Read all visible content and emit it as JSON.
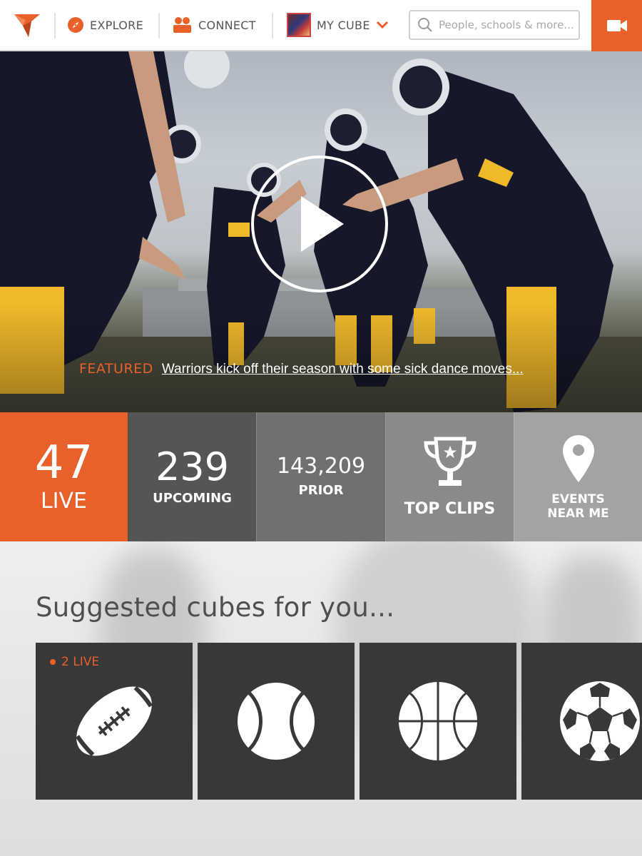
{
  "nav": {
    "explore_label": "EXPLORE",
    "connect_label": "CONNECT",
    "my_cube_label": "MY CUBE",
    "search_placeholder": "People, schools & more...",
    "accent_color": "#e8612a"
  },
  "hero": {
    "featured_tag": "FEATURED",
    "featured_title": "Warriors kick off their season with some sick dance moves..."
  },
  "stats": {
    "live": {
      "value": "47",
      "label": "LIVE"
    },
    "upcoming": {
      "value": "239",
      "label": "UPCOMING"
    },
    "prior": {
      "value": "143,209",
      "label": "PRIOR"
    },
    "top_clips": {
      "label": "TOP CLIPS",
      "icon": "trophy-icon"
    },
    "events": {
      "label_line1": "EVENTS",
      "label_line2": "NEAR ME",
      "icon": "map-pin-icon"
    }
  },
  "suggested": {
    "title": "Suggested cubes for you...",
    "cards": [
      {
        "sport_icon": "football-icon",
        "live_badge": "2 LIVE"
      },
      {
        "sport_icon": "tennis-ball-icon"
      },
      {
        "sport_icon": "basketball-icon"
      },
      {
        "sport_icon": "soccer-ball-icon"
      }
    ]
  }
}
